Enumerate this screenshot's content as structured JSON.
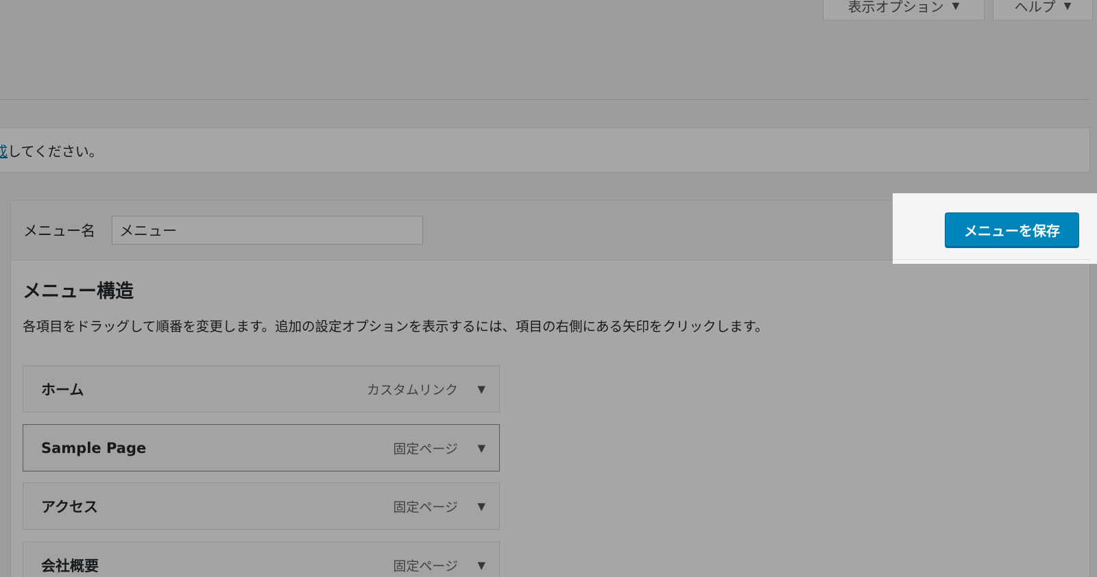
{
  "screen_meta": {
    "display_options_label": "表示オプション",
    "help_label": "ヘルプ",
    "arrow_glyph": "▼"
  },
  "notice": {
    "link_fragment": "成",
    "text": "してください。"
  },
  "menu_settings": {
    "name_label": "メニュー名",
    "name_value": "メニュー",
    "save_button_label": "メニューを保存"
  },
  "menu_structure": {
    "title": "メニュー構造",
    "description": "各項目をドラッグして順番を変更します。追加の設定オプションを表示するには、項目の右側にある矢印をクリックします。",
    "items": [
      {
        "title": "ホーム",
        "type": "カスタムリンク"
      },
      {
        "title": "Sample Page",
        "type": "固定ページ"
      },
      {
        "title": "アクセス",
        "type": "固定ページ"
      },
      {
        "title": "会社概要",
        "type": "固定ページ"
      }
    ]
  },
  "colors": {
    "primary_button": "#0085ba",
    "link": "#0073aa",
    "overlay": "rgba(0,0,0,0.35)"
  }
}
